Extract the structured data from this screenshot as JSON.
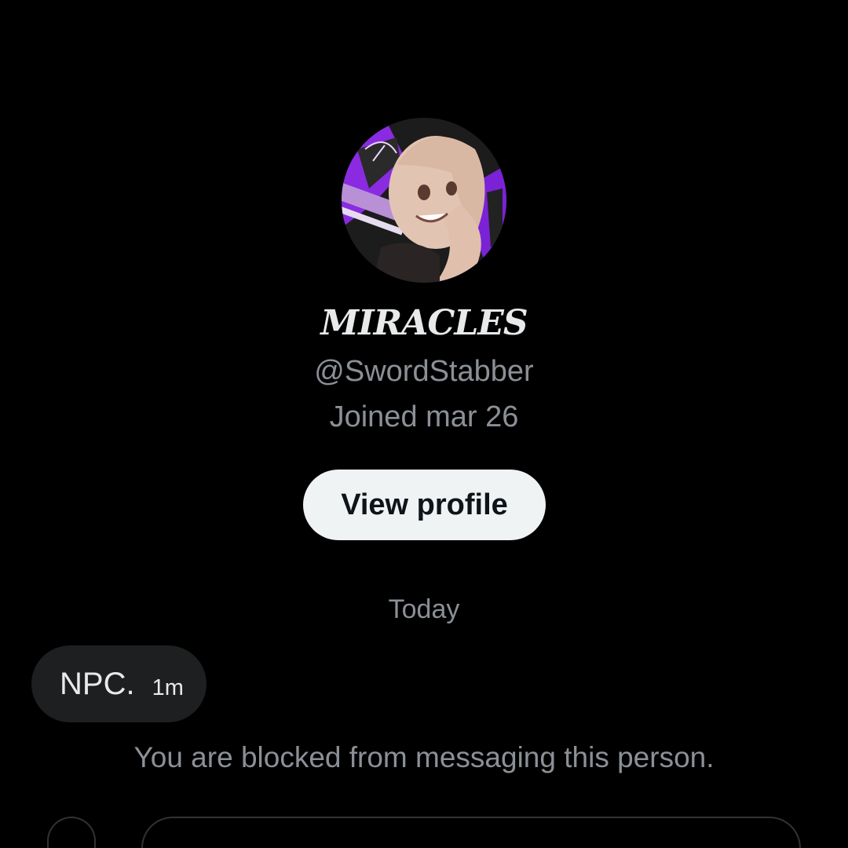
{
  "profile": {
    "display_name": "MIRACLES",
    "handle": "@SwordStabber",
    "joined": "Joined mar 26",
    "view_profile_label": "View profile"
  },
  "conversation": {
    "date_separator": "Today",
    "messages": [
      {
        "text": "NPC.",
        "time": "1m"
      }
    ],
    "blocked_notice": "You are blocked from messaging this person."
  },
  "colors": {
    "background": "#000000",
    "primary_text": "#e7e9ea",
    "secondary_text": "#8b9096",
    "button_bg": "#eff3f4",
    "bubble_bg": "#1d1f21",
    "avatar_accent": "#8a2be2"
  }
}
